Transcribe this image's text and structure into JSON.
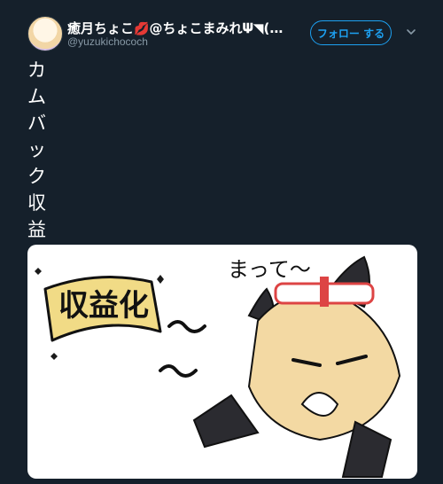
{
  "user": {
    "display_name": "癒月ちょこ",
    "display_name_suffix": "@ちょこまみれ𝚿◥(□...",
    "handle": "@yuzukichococh",
    "emoji_icon": "kiss-mark-icon"
  },
  "actions": {
    "follow_label": "フォロー する",
    "more_icon": "chevron-down-icon"
  },
  "tweet": {
    "text": "カムバック収益化"
  },
  "media": {
    "sign_text": "収益化",
    "speech_text": "まって〜"
  },
  "colors": {
    "background": "#15202b",
    "accent": "#1da1f2",
    "muted": "#8899a6"
  }
}
